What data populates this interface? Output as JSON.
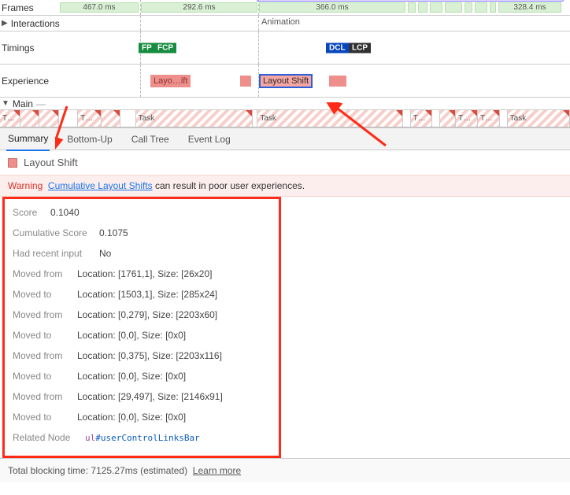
{
  "rows": {
    "frames": "Frames",
    "interactions": "Interactions",
    "timings": "Timings",
    "experience": "Experience",
    "main": "Main",
    "animation": "Animation"
  },
  "frames": {
    "f1": "467.0 ms",
    "f2": "292.6 ms",
    "f3": "366.0 ms",
    "f4": "328.4 ms"
  },
  "timings": {
    "fp": "FP",
    "fcp": "FCP",
    "dcl": "DCL",
    "lcp": "LCP"
  },
  "experience": {
    "layo_ift": "Layo…ift",
    "layout_shift": "Layout Shift"
  },
  "tasks": {
    "t": "T…",
    "task": "Task"
  },
  "tabs": {
    "summary": "Summary",
    "bottomup": "Bottom-Up",
    "calltree": "Call Tree",
    "eventlog": "Event Log"
  },
  "ls_title": "Layout Shift",
  "warning": {
    "warn": "Warning",
    "link": "Cumulative Layout Shifts",
    "tail": " can result in poor user experiences."
  },
  "details": {
    "score_l": "Score",
    "score_v": "0.1040",
    "cum_l": "Cumulative Score",
    "cum_v": "0.1075",
    "hri_l": "Had recent input",
    "hri_v": "No",
    "mf1_l": "Moved from",
    "mf1_v": "Location: [1761,1], Size: [26x20]",
    "mt1_l": "Moved to",
    "mt1_v": "Location: [1503,1], Size: [285x24]",
    "mf2_l": "Moved from",
    "mf2_v": "Location: [0,279], Size: [2203x60]",
    "mt2_l": "Moved to",
    "mt2_v": "Location: [0,0], Size: [0x0]",
    "mf3_l": "Moved from",
    "mf3_v": "Location: [0,375], Size: [2203x116]",
    "mt3_l": "Moved to",
    "mt3_v": "Location: [0,0], Size: [0x0]",
    "mf4_l": "Moved from",
    "mf4_v": "Location: [29,497], Size: [2146x91]",
    "mt4_l": "Moved to",
    "mt4_v": "Location: [0,0], Size: [0x0]",
    "rn_l": "Related Node",
    "rn_tag": "ul",
    "rn_sel": "#userControlLinksBar"
  },
  "footer": {
    "prefix": "Total blocking time: ",
    "value": "7125.27ms (estimated)",
    "link": "Learn more"
  }
}
